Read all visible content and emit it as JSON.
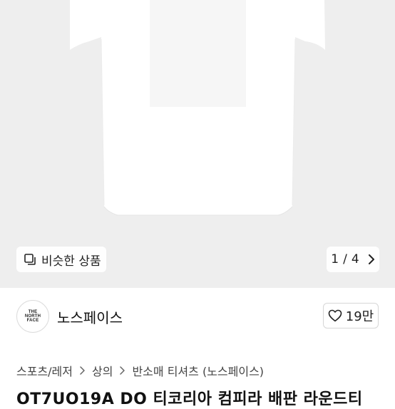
{
  "hero": {
    "similar_label": "비슷한 상품",
    "pager_current": "1",
    "pager_total": "4"
  },
  "seller": {
    "logo_lines": [
      "THE",
      "NORTH",
      "FACE"
    ],
    "name": "노스페이스",
    "likes": "19만"
  },
  "breadcrumb": [
    "스포츠/레저",
    "상의",
    "반소매 티셔츠 (노스페이스)"
  ],
  "product_title_partial": "OT7UO19A DO 티코리아 컴피라 배판 라운드티",
  "colors": {
    "hero_bg": "#eeeeee",
    "text": "#222222"
  }
}
